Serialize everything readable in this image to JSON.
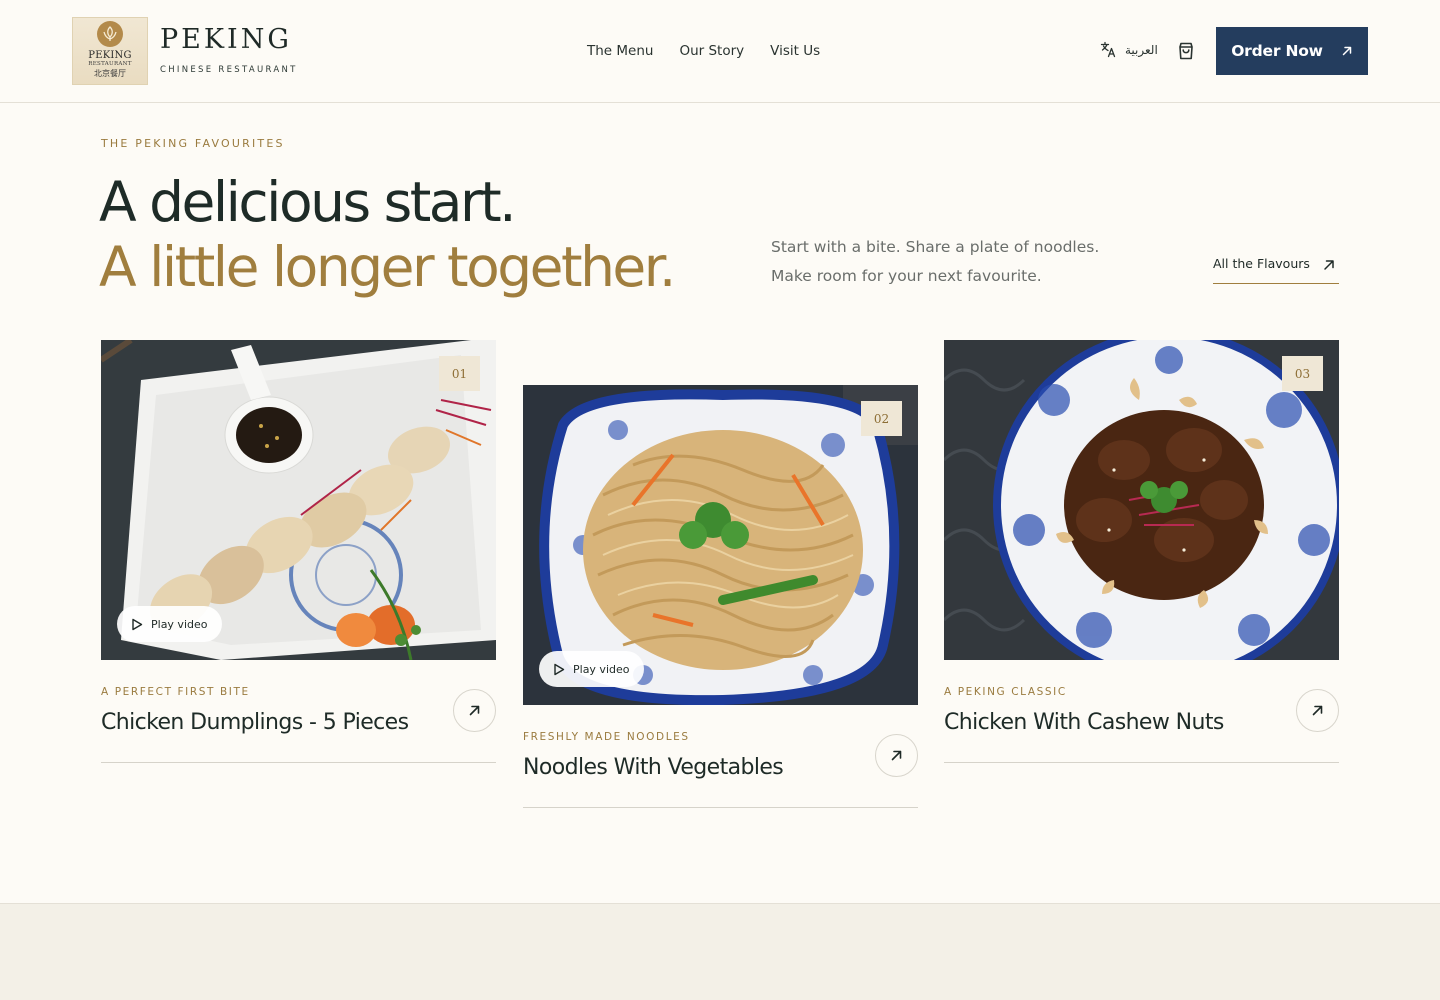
{
  "header": {
    "logo": {
      "line1": "PEKING",
      "line2": "RESTAURANT",
      "line3": "北京餐厅"
    },
    "brand_name": "PEKING",
    "brand_sub": "CHINESE RESTAURANT",
    "nav": [
      "The Menu",
      "Our Story",
      "Visit Us"
    ],
    "language_label": "العربية",
    "order_button": "Order Now"
  },
  "intro": {
    "eyebrow": "THE PEKING FAVOURITES",
    "headline_1": "A delicious start.",
    "headline_2": "A little longer together.",
    "text_line_1": "Start with a bite. Share a plate of noodles.",
    "text_line_2": "Make room for your next favourite.",
    "link_label": "All the Flavours"
  },
  "cards": [
    {
      "number": "01",
      "play_label": "Play video",
      "eyebrow": "A PERFECT FIRST BITE",
      "title": "Chicken Dumplings - 5 Pieces"
    },
    {
      "number": "02",
      "play_label": "Play video",
      "eyebrow": "FRESHLY MADE NOODLES",
      "title": "Noodles With Vegetables"
    },
    {
      "number": "03",
      "eyebrow": "A PEKING CLASSIC",
      "title": "Chicken With Cashew Nuts"
    }
  ],
  "colors": {
    "background": "#fdfbf6",
    "accent_gold": "#a07e3e",
    "primary_navy": "#243d5e",
    "text_dark": "#1e2b27"
  },
  "icons": [
    "translate-icon",
    "shopping-bag-icon",
    "arrow-up-right-icon",
    "play-icon"
  ]
}
